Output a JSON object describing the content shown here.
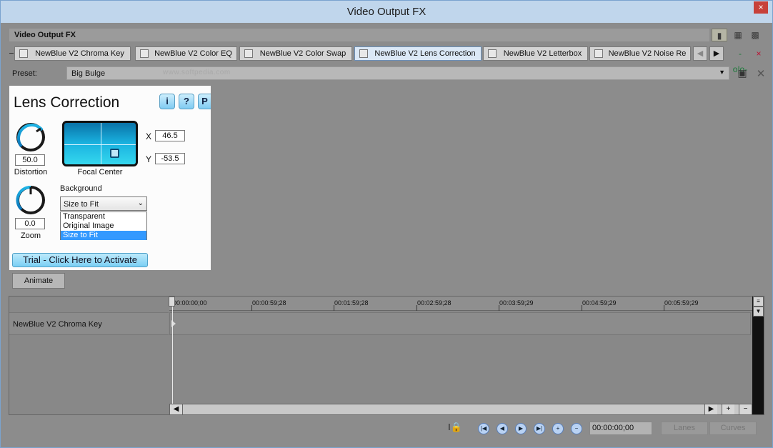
{
  "window": {
    "title": "Video Output FX",
    "close_glyph": "×"
  },
  "fx_header": {
    "title": "Video Output FX"
  },
  "view_icons": [
    "view-single-icon",
    "view-double-icon",
    "view-grid-icon"
  ],
  "chain": {
    "tabs": [
      {
        "label": "NewBlue V2 Chroma Key",
        "checked": false
      },
      {
        "label": "NewBlue V2 Color EQ",
        "checked": false
      },
      {
        "label": "NewBlue V2 Color Swap",
        "checked": false
      },
      {
        "label": "NewBlue V2 Lens Correction",
        "checked": false,
        "selected": true
      },
      {
        "label": "NewBlue V2 Letterbox",
        "checked": false
      },
      {
        "label": "NewBlue V2 Noise Re",
        "checked": false
      }
    ],
    "nav_left": "◀",
    "nav_right": "▶",
    "icons": [
      "plugin-chain-icon",
      "remove-plugin-icon"
    ]
  },
  "preset": {
    "label": "Preset:",
    "value": "Big Bulge",
    "watermark": "www.softpedia.com"
  },
  "plugin": {
    "title": "Lens Correction",
    "buttons": [
      "i",
      "?",
      "P"
    ],
    "distortion": {
      "value": "50.0",
      "label": "Distortion"
    },
    "zoom": {
      "value": "0.0",
      "label": "Zoom"
    },
    "focal_center": {
      "label": "Focal Center",
      "x_label": "X",
      "x_value": "46.5",
      "y_label": "Y",
      "y_value": "-53.5"
    },
    "background": {
      "label": "Background",
      "selected": "Size to Fit",
      "options": [
        "Transparent",
        "Original Image",
        "Size to Fit"
      ]
    },
    "trial_button": "Trial - Click Here to Activate"
  },
  "animate_button": "Animate",
  "timeline": {
    "ticks": [
      "00:00:00;00",
      "00:00:59;28",
      "00:01:59;28",
      "00:02:59;28",
      "00:03:59;29",
      "00:04:59;29",
      "00:05:59;29"
    ],
    "track_label": "NewBlue V2 Chroma Key"
  },
  "transport": {
    "timecode": "00:00:00;00",
    "lanes_label": "Lanes",
    "curves_label": "Curves",
    "icons": [
      "lock-icon",
      "first-keyframe-icon",
      "prev-keyframe-icon",
      "next-keyframe-icon",
      "last-keyframe-icon",
      "add-keyframe-icon",
      "delete-keyframe-icon"
    ]
  }
}
